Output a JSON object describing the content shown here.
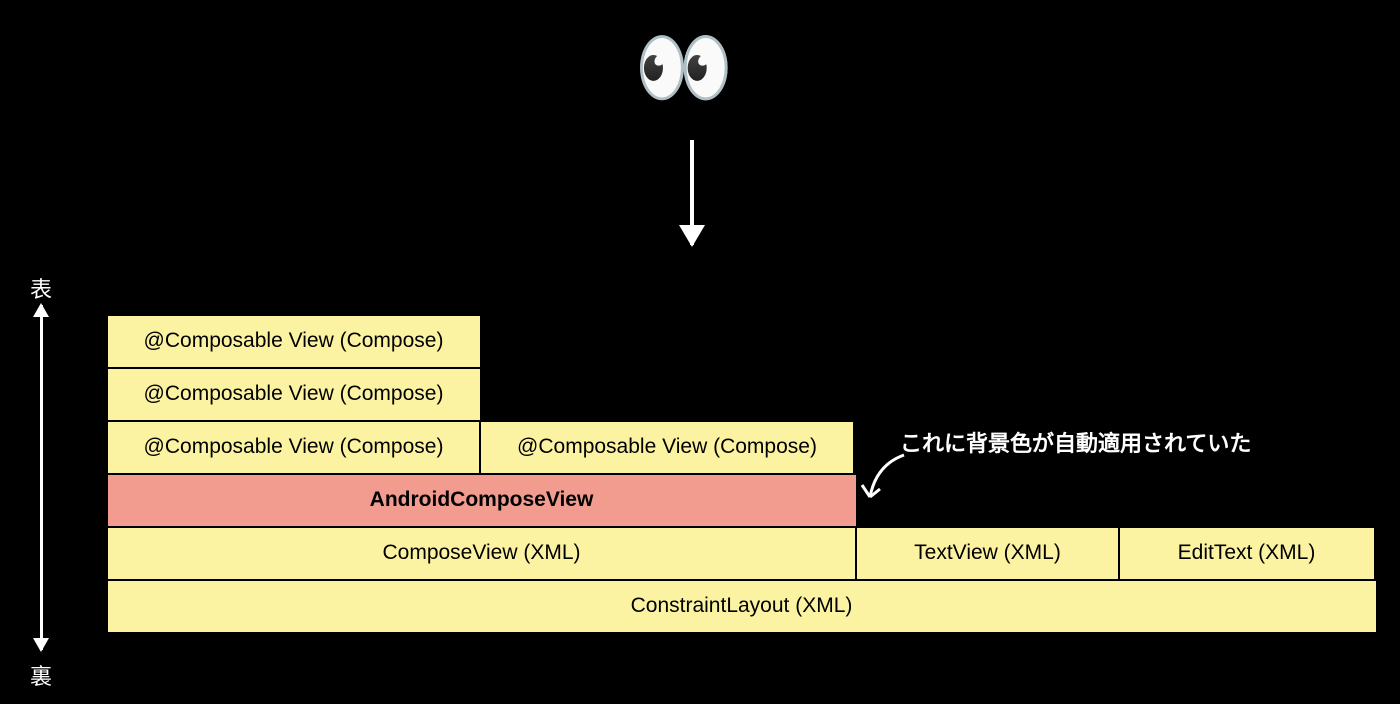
{
  "emoji": "👀",
  "axis": {
    "top": "表",
    "bottom": "裏"
  },
  "layers": {
    "c1": "@Composable View (Compose)",
    "c2": "@Composable View (Compose)",
    "c3a": "@Composable View (Compose)",
    "c3b": "@Composable View (Compose)",
    "acv": "AndroidComposeView",
    "cv": "ComposeView (XML)",
    "tv": "TextView (XML)",
    "et": "EditText (XML)",
    "cl": "ConstraintLayout (XML)"
  },
  "annotation": "これに背景色が自動適用されていた"
}
